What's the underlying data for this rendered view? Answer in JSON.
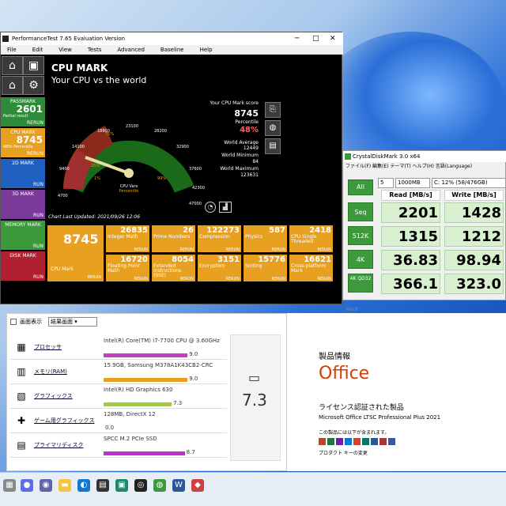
{
  "pt": {
    "title": "PerformanceTest 7.65 Evaluation Version",
    "menu": [
      "File",
      "Edit",
      "View",
      "Tests",
      "Advanced",
      "Baseline",
      "Help"
    ],
    "heading": "CPU MARK",
    "subheading": "Your CPU vs the world",
    "marks": [
      {
        "label": "PASSMARK",
        "value": "2601",
        "sub": "Partial result",
        "run": "RERUN",
        "color": "#2e8b3a"
      },
      {
        "label": "CPU MARK",
        "value": "8745",
        "sub": "48th Percentile",
        "run": "RERUN",
        "color": "#e8a020"
      },
      {
        "label": "2D MARK",
        "value": "",
        "sub": "",
        "run": "RUN",
        "color": "#2060c0"
      },
      {
        "label": "3D MARK",
        "value": "",
        "sub": "",
        "run": "RUN",
        "color": "#7a3a9a"
      },
      {
        "label": "MEMORY MARK",
        "value": "",
        "sub": "",
        "run": "RUN",
        "color": "#3a9a3a"
      },
      {
        "label": "DISK MARK",
        "value": "",
        "sub": "",
        "run": "RUN",
        "color": "#b02030"
      }
    ],
    "score_label": "Your CPU Mark score",
    "score": "8745",
    "percentile_label": "Percentile",
    "percentile": "48%",
    "world_avg_label": "World Average",
    "world_avg": "12449",
    "world_min_label": "World Minimum",
    "world_min": "84",
    "world_max_label": "World Maximum",
    "world_max": "123631",
    "gauge_ticks": [
      "4700",
      "9400",
      "14100",
      "18800",
      "23100",
      "28200",
      "32900",
      "37600",
      "42300",
      "47000"
    ],
    "gauge_pcts": [
      "75%",
      "25%",
      "1%",
      "99%"
    ],
    "gauge_center": "CPU Vars",
    "gauge_center2": "Percentile",
    "updated": "Chart Last Updated: 2021/09/26  12:06",
    "big_value": "8745",
    "big_label": "CPU Mark",
    "big_run": "RERUN",
    "tiles": [
      {
        "value": "26835",
        "name": "Integer Math"
      },
      {
        "value": "26",
        "name": "Prime Numbers"
      },
      {
        "value": "122273",
        "name": "Compression"
      },
      {
        "value": "587",
        "name": "Physics"
      },
      {
        "value": "2418",
        "name": "CPU Single Threaded"
      },
      {
        "value": "16720",
        "name": "Floating Point Math"
      },
      {
        "value": "8054",
        "name": "Extended Instructions (SSE)"
      },
      {
        "value": "3151",
        "name": "Encryption"
      },
      {
        "value": "15776",
        "name": "Sorting"
      },
      {
        "value": "16621",
        "name": "Cross-platform Mark"
      }
    ],
    "tile_run": "RERUN"
  },
  "cdm": {
    "title": "CrystalDiskMark 3.0 x64",
    "menu": "ファイル(F)  編集(E)  テーマ(T)  ヘルプ(H)  言語(Language)",
    "all": "All",
    "count": "5",
    "size": "1000MB",
    "drive": "C: 12% (58/476GB)",
    "read_hdr": "Read [MB/s]",
    "write_hdr": "Write [MB/s]",
    "rows": [
      {
        "label": "Seq",
        "read": "2201",
        "write": "1428"
      },
      {
        "label": "512K",
        "read": "1315",
        "write": "1212"
      },
      {
        "label": "4K",
        "read": "36.83",
        "write": "98.94"
      },
      {
        "label": "4K QD32",
        "read": "366.1",
        "write": "323.0"
      }
    ]
  },
  "we": {
    "view_label": "画面表示",
    "view_value": "結果画面",
    "rows": [
      {
        "label": "プロセッサ",
        "icon": "cpu",
        "desc": "Intel(R) Core(TM) i7-7700 CPU @ 3.60GHz",
        "score": "9.0",
        "bar": 0.9,
        "color": "#c040c0"
      },
      {
        "label": "メモリ(RAM)",
        "icon": "memory",
        "desc": "15.9GB, Samsung M378A1K43CB2-CRC",
        "score": "9.0",
        "bar": 0.9,
        "color": "#e8a020"
      },
      {
        "label": "グラフィックス",
        "icon": "graphics",
        "desc": "Intel(R) HD Graphics 630",
        "score": "7.3",
        "bar": 0.73,
        "color": "#a0d030"
      },
      {
        "label": "ゲーム用グラフィックス",
        "icon": "game",
        "desc": "128MB, DirectX 12",
        "score": "0.0",
        "bar": 0.0,
        "color": "#808080"
      },
      {
        "label": "プライマリディスク",
        "icon": "disk",
        "desc": "SPCC M.2 PCIe SSD",
        "score": "8.7",
        "bar": 0.87,
        "color": "#c030d0"
      }
    ],
    "total": "7.3"
  },
  "office": {
    "header": "製品情報",
    "brand": "Office",
    "licensed": "ライセンス認証された製品",
    "product": "Microsoft Office LTSC Professional Plus 2021",
    "contains": "この製品には以下が含まれます。",
    "change_key": "プロダクト キーの変更",
    "word_label": "Word",
    "brand_color": "#d83b01"
  }
}
